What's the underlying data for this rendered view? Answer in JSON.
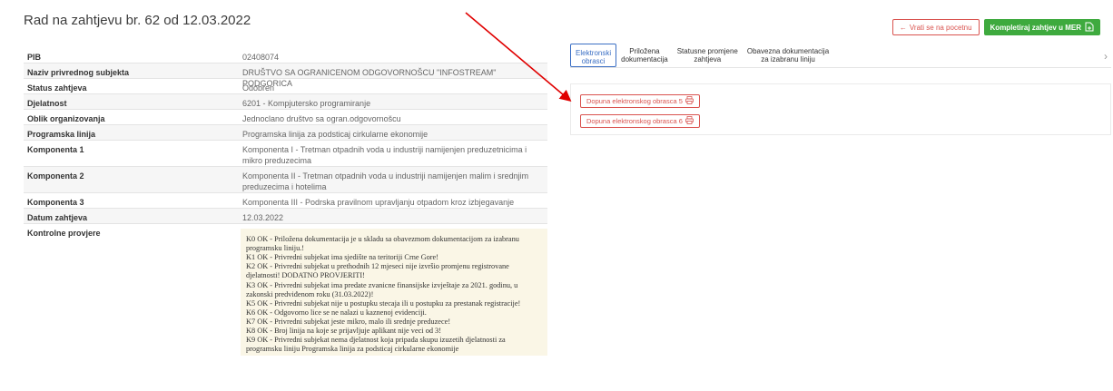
{
  "page": {
    "title": "Rad na zahtjevu br. 62 od 12.03.2022"
  },
  "actions": {
    "back_label": "Vrati se na pocetnu",
    "complete_label": "Kompletiraj zahtjev u MER"
  },
  "details": [
    {
      "label": "PIB",
      "value": "02408074"
    },
    {
      "label": "Naziv privrednog subjekta",
      "value": "DRUŠTVO SA OGRANICENOM ODGOVORNOŠCU \"INFOSTREAM\" PODGORICA"
    },
    {
      "label": "Status zahtjeva",
      "value": "Odobren"
    },
    {
      "label": "Djelatnost",
      "value": "6201 - Kompjutersko programiranje"
    },
    {
      "label": "Oblik organizovanja",
      "value": "Jednoclano društvo sa ogran.odgovornošcu"
    },
    {
      "label": "Programska linija",
      "value": "Programska linija za podsticaj cirkularne ekonomije"
    },
    {
      "label": "Komponenta 1",
      "value": "Komponenta I - Tretman otpadnih voda u industriji namijenjen preduzetnicima i mikro preduzecima"
    },
    {
      "label": "Komponenta 2",
      "value": "Komponenta II - Tretman otpadnih voda u industriji namijenjen malim i srednjim preduzecima i hotelima"
    },
    {
      "label": "Komponenta 3",
      "value": "Komponenta III - Podrska pravilnom upravljanju otpadom kroz izbjegavanje"
    },
    {
      "label": "Datum zahtjeva",
      "value": "12.03.2022"
    }
  ],
  "checks": {
    "label": "Kontrolne provjere",
    "lines": [
      "K0 OK - Priložena dokumentacija je u skladu sa obavezmom dokumentacijom za izabranu programsku liniju.!",
      "K1 OK - Privredni subjekat ima sjedište na teritoriji Crne Gore!",
      "K2 OK - Privredni subjekat u prethodnih 12 mjeseci nije izvršio promjenu registrovane djelatnosti! DODATNO PROVJERITI!",
      "K3 OK - Privredni subjekat ima predate zvanicne finansijske izvještaje za 2021. godinu, u zakonski predviđenom roku (31.03.2022)!",
      "K5 OK - Privredni subjekat nije u postupku stecaja ili u postupku za prestanak registracije!",
      "K6 OK - Odgovorno lice se ne nalazi u kaznenoj evidenciji.",
      "K7 OK - Privredni subjekat jeste mikro, malo ili srednje preduzece!",
      "K8 OK - Broj linija na koje se prijavljuje aplikant nije veci od 3!",
      "K9 OK - Privredni subjekat nema djelatnost koja pripada skupu izuzetih djelatnosti za programsku liniju Programska linija za podsticaj cirkularne ekonomije"
    ]
  },
  "tabs": [
    {
      "line1": "Elektronski",
      "line2": "obrasci"
    },
    {
      "line1": "Priložena",
      "line2": "dokumentacija"
    },
    {
      "line1": "Statusne promjene",
      "line2": "zahtjeva"
    },
    {
      "line1": "Obavezna dokumentacija",
      "line2": "za izabranu liniju"
    }
  ],
  "forms": [
    "Dopuna elektronskog obrasca 5",
    "Dopuna elektronskog obrasca 6"
  ],
  "colors": {
    "accent_red": "#d9534f",
    "accent_green": "#3eaa3e",
    "tab_active": "#3b6fc4",
    "annotation_arrow": "#e00000"
  }
}
